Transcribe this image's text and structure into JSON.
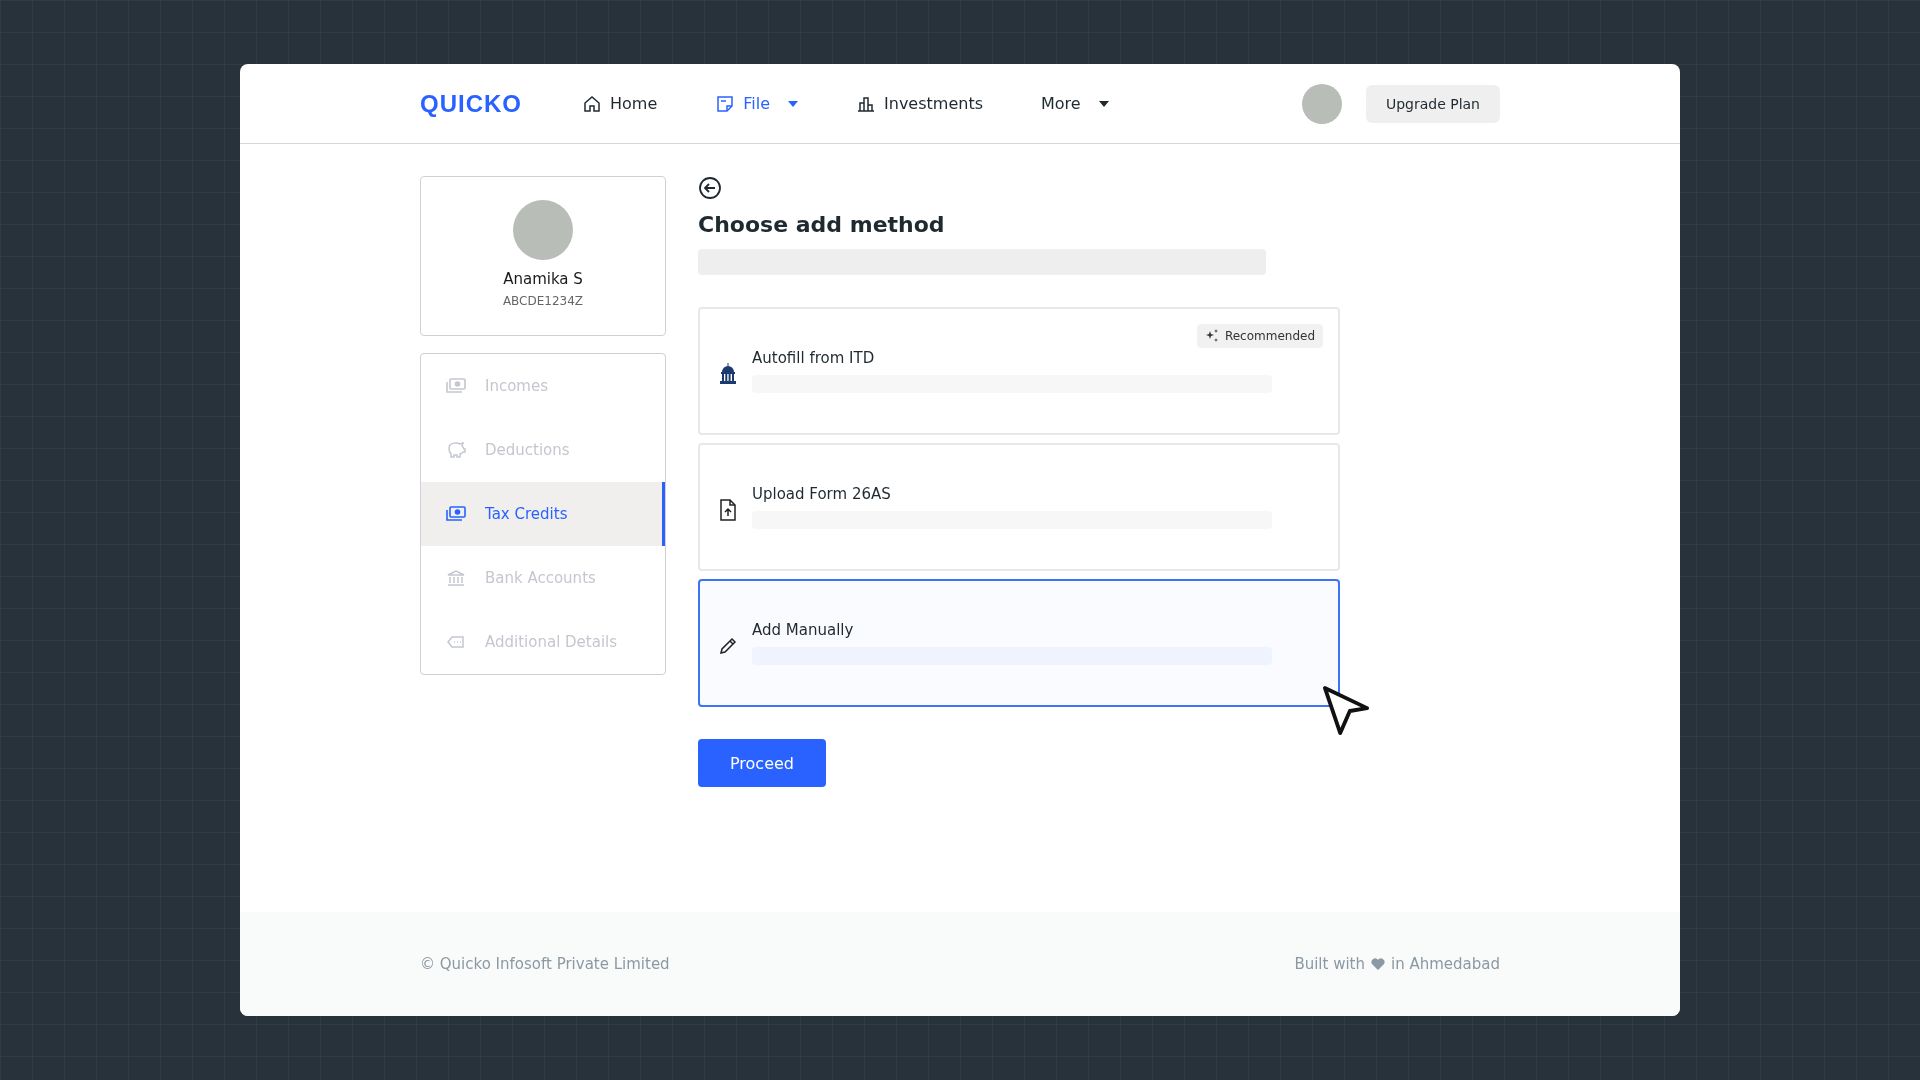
{
  "header": {
    "logo": "QUICKO",
    "nav": [
      {
        "label": "Home",
        "kind": "home",
        "selected": false,
        "dropdown": false
      },
      {
        "label": "File",
        "kind": "file",
        "selected": true,
        "dropdown": true
      },
      {
        "label": "Investments",
        "kind": "chart",
        "selected": false,
        "dropdown": false
      },
      {
        "label": "More",
        "kind": "none",
        "selected": false,
        "dropdown": true
      }
    ],
    "upgrade_button": "Upgrade Plan"
  },
  "profile": {
    "name": "Anamika S",
    "pan": "ABCDE1234Z"
  },
  "sidebar": {
    "items": [
      {
        "label": "Incomes",
        "kind": "cash",
        "selected": false
      },
      {
        "label": "Deductions",
        "kind": "piggy",
        "selected": false
      },
      {
        "label": "Tax Credits",
        "kind": "cash",
        "selected": true
      },
      {
        "label": "Bank Accounts",
        "kind": "bank",
        "selected": false
      },
      {
        "label": "Additional Details",
        "kind": "tag",
        "selected": false
      }
    ]
  },
  "main": {
    "title": "Choose add method",
    "options": [
      {
        "title": "Autofill from ITD",
        "kind": "government",
        "badge": "Recommended",
        "selected": false
      },
      {
        "title": "Upload Form 26AS",
        "kind": "upload",
        "selected": false
      },
      {
        "title": "Add Manually",
        "kind": "pencil",
        "selected": true
      }
    ],
    "proceed_button": "Proceed"
  },
  "footer": {
    "copyright": "© Quicko Infosoft Private Limited",
    "built_with": "Built with",
    "location": "in Ahmedabad"
  }
}
